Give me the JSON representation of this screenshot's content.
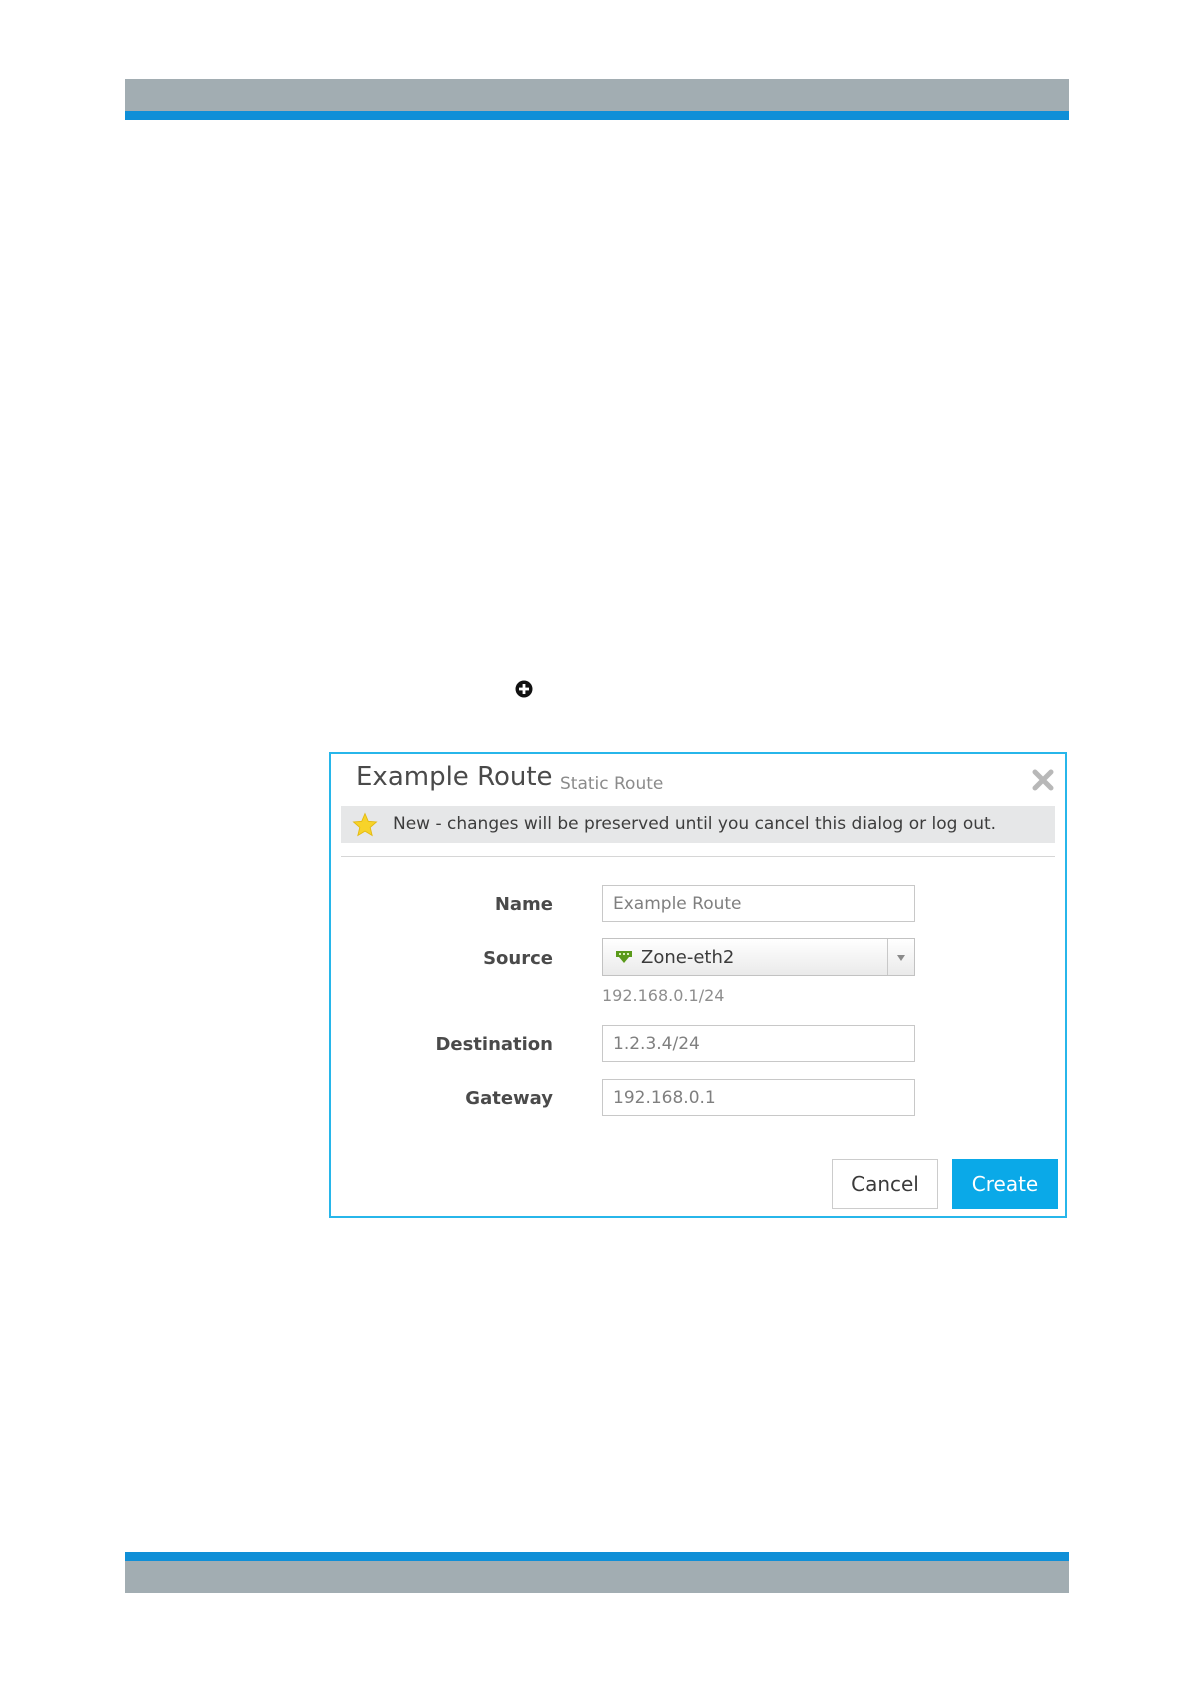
{
  "dialog": {
    "title": "Example Route",
    "subtitle": "Static Route",
    "notice": "New - changes will be preserved until you cancel this dialog or log out.",
    "fields": {
      "name": {
        "label": "Name",
        "value": "Example Route"
      },
      "source": {
        "label": "Source",
        "value": "Zone-eth2",
        "hint": "192.168.0.1/24"
      },
      "destination": {
        "label": "Destination",
        "value": "1.2.3.4/24"
      },
      "gateway": {
        "label": "Gateway",
        "value": "192.168.0.1"
      }
    },
    "buttons": {
      "cancel": "Cancel",
      "create": "Create"
    }
  },
  "icons": [
    "plus-circle-icon",
    "close-icon",
    "star-icon",
    "network-zone-icon",
    "chevron-down-icon"
  ],
  "colors": {
    "accent": "#0aa9e8",
    "dialog_border": "#27b6ea",
    "header_band_gray": "#a2adb2",
    "header_band_blue": "#0f8fd7",
    "notice_bg": "#e6e7e8",
    "star": "#f7d32a",
    "zone_icon": "#5a9a1a"
  }
}
